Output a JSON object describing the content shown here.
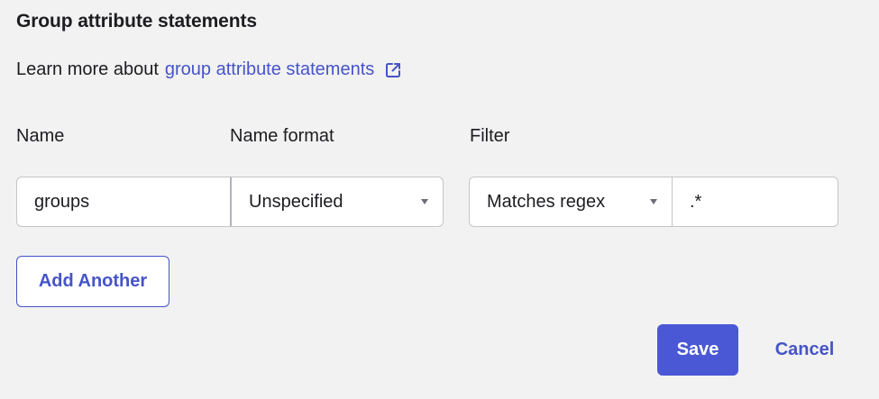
{
  "section": {
    "title": "Group attribute statements",
    "learn_more_prefix": "Learn more about",
    "learn_more_link": "group attribute statements",
    "link_icon": "external-link-icon"
  },
  "columns": {
    "name": "Name",
    "name_format": "Name format",
    "filter": "Filter"
  },
  "row": {
    "name_value": "groups",
    "name_format_selected": "Unspecified",
    "filter_type_selected": "Matches regex",
    "filter_value": ".*"
  },
  "buttons": {
    "add_another": "Add Another",
    "save": "Save",
    "cancel": "Cancel"
  },
  "colors": {
    "accent": "#4554c8",
    "primary_button": "#4a58d6",
    "background": "#f2f2f2"
  }
}
